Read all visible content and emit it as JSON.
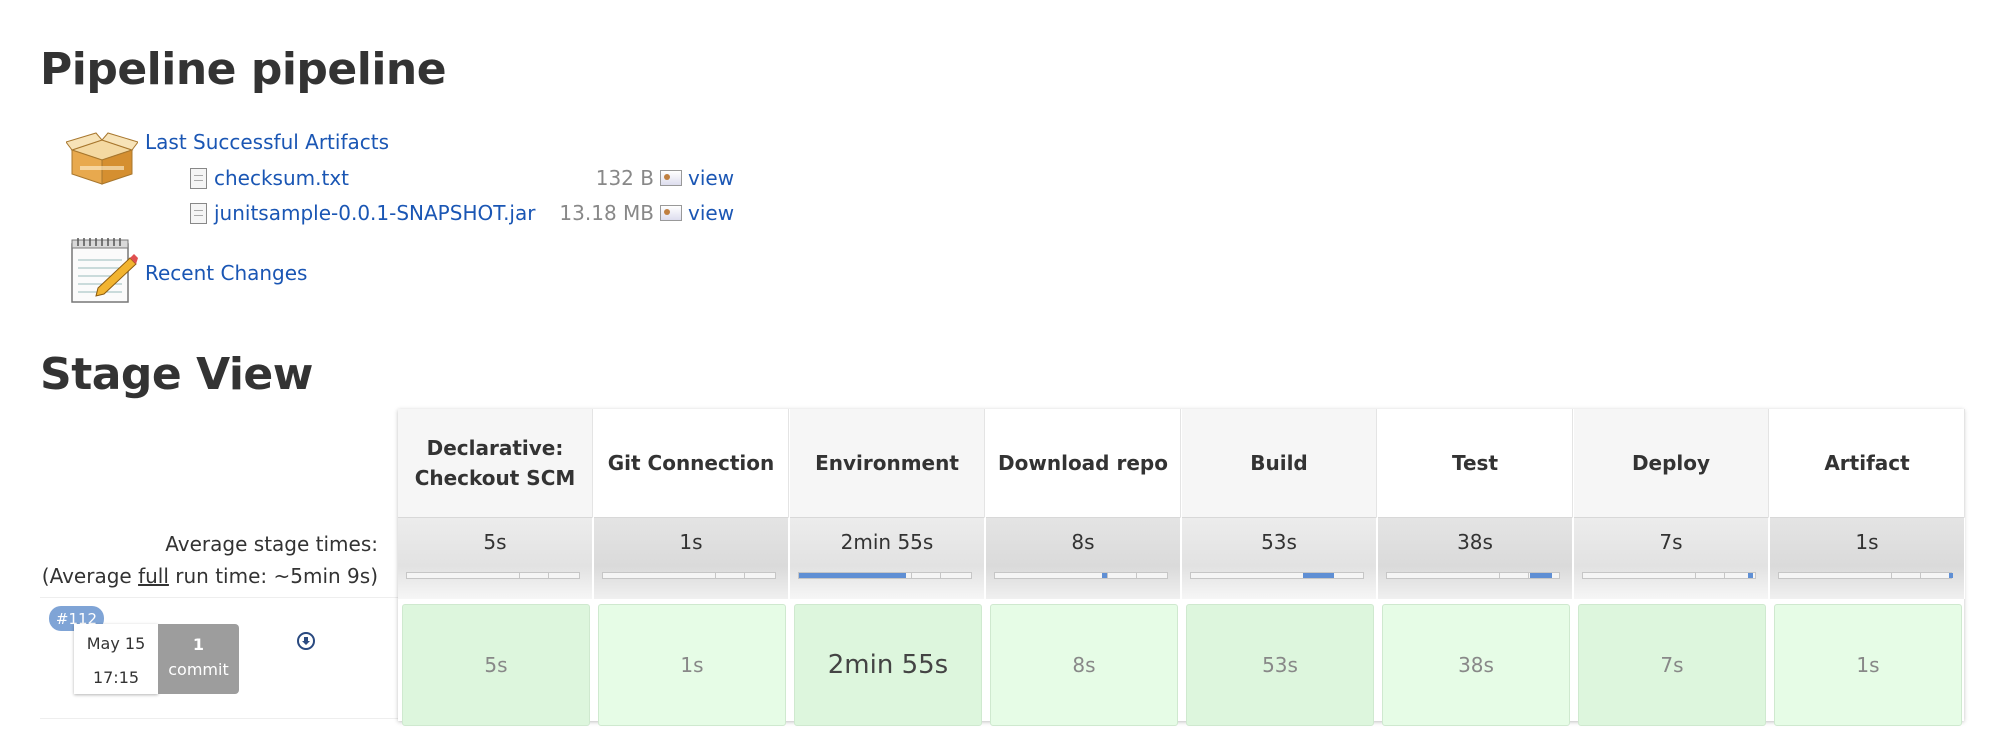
{
  "page": {
    "title": "Pipeline pipeline"
  },
  "artifacts": {
    "section_label": "Last Successful Artifacts",
    "files": [
      {
        "name": "checksum.txt",
        "size": "132 B",
        "view_label": "view"
      },
      {
        "name": "junitsample-0.0.1-SNAPSHOT.jar",
        "size": "13.18 MB",
        "view_label": "view"
      }
    ]
  },
  "recent_changes": {
    "label": "Recent Changes"
  },
  "stage_view": {
    "title": "Stage View",
    "average_label": "Average stage times:",
    "average_full_prefix": "(Average ",
    "average_full_word": "full",
    "average_full_suffix": " run time: ~5min 9s)",
    "stages": [
      {
        "name": "Declarative: Checkout SCM",
        "avg": "5s",
        "bar_fill_start": 0.0,
        "bar_fill_end": 0.0,
        "run_time": "5s"
      },
      {
        "name": "Git Connection",
        "avg": "1s",
        "bar_fill_start": 0.0,
        "bar_fill_end": 0.0,
        "run_time": "1s"
      },
      {
        "name": "Environment",
        "avg": "2min 55s",
        "bar_fill_start": 0.0,
        "bar_fill_end": 0.62,
        "run_time": "2min 55s"
      },
      {
        "name": "Download repo",
        "avg": "8s",
        "bar_fill_start": 0.62,
        "bar_fill_end": 0.65,
        "run_time": "8s"
      },
      {
        "name": "Build",
        "avg": "53s",
        "bar_fill_start": 0.65,
        "bar_fill_end": 0.83,
        "run_time": "53s"
      },
      {
        "name": "Test",
        "avg": "38s",
        "bar_fill_start": 0.83,
        "bar_fill_end": 0.96,
        "run_time": "38s"
      },
      {
        "name": "Deploy",
        "avg": "7s",
        "bar_fill_start": 0.96,
        "bar_fill_end": 0.99,
        "run_time": "7s"
      },
      {
        "name": "Artifact",
        "avg": "1s",
        "bar_fill_start": 0.99,
        "bar_fill_end": 1.0,
        "run_time": "1s"
      }
    ],
    "build": {
      "number": "#112",
      "date": "May 15",
      "time": "17:15",
      "commit_count": "1",
      "commit_label": "commit"
    }
  },
  "colors": {
    "link": "#1a56b4",
    "success_cell": "#e6fce6",
    "bar_fill": "#5f8fd4",
    "badge": "#7fa4d6"
  }
}
